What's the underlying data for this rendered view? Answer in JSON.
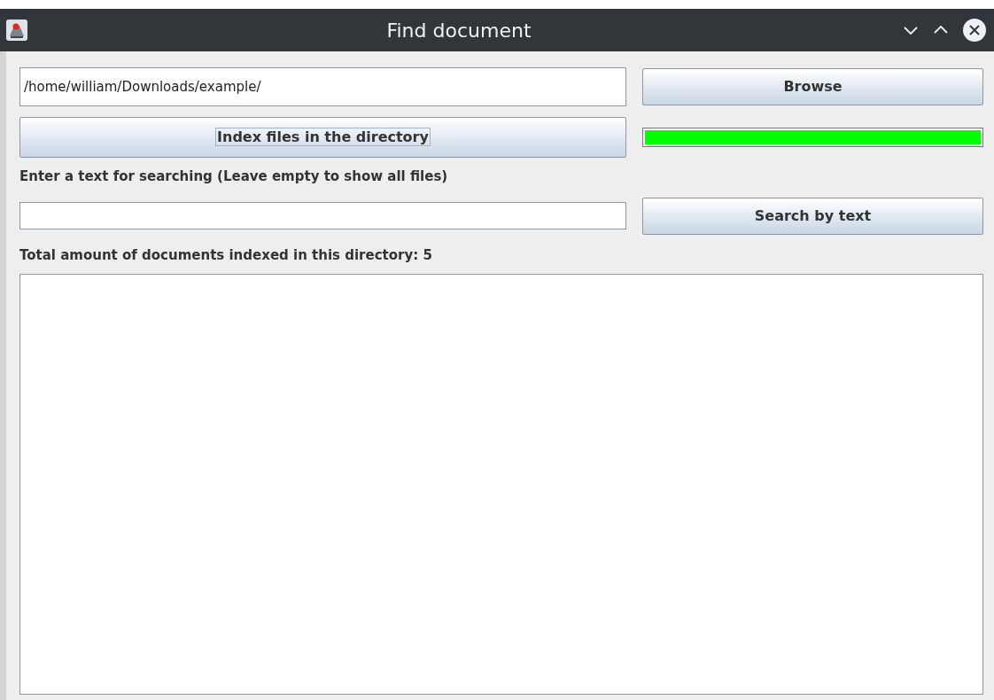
{
  "window": {
    "title": "Find document"
  },
  "directory_field": {
    "value": "/home/william/Downloads/example/"
  },
  "browse_button": {
    "label": "Browse"
  },
  "index_button": {
    "label": "Index files in the directory",
    "focused": true
  },
  "progress": {
    "level": 1.0
  },
  "search_label": "Enter a text for searching (Leave empty to show all files)",
  "search_button": {
    "label": "Search by text"
  },
  "total_label": "Total amount of documents indexed in this directory: 5"
}
